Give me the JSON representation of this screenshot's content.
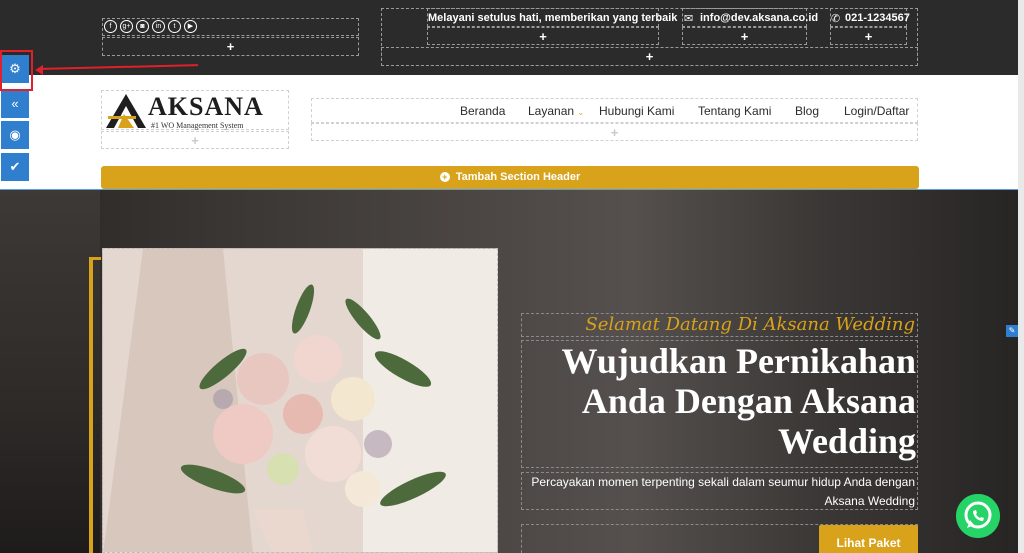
{
  "topbar": {
    "social_icons": [
      "facebook-icon",
      "google-plus-icon",
      "instagram-icon",
      "linkedin-icon",
      "twitter-icon",
      "youtube-icon"
    ],
    "tagline": "Melayani setulus hati, memberikan yang terbaik",
    "email": "info@dev.aksana.co.id",
    "phone": "021-1234567",
    "plus": "+"
  },
  "editor": {
    "tools": [
      "settings-icon",
      "collapse-icon",
      "preview-icon",
      "check-icon"
    ]
  },
  "brand": {
    "name": "AKSANA",
    "tagline": "#1 WO Management System"
  },
  "nav": {
    "items": [
      {
        "label": "Beranda"
      },
      {
        "label": "Layanan"
      },
      {
        "label": "Hubungi Kami"
      },
      {
        "label": "Tentang Kami"
      },
      {
        "label": "Blog"
      },
      {
        "label": "Login/Daftar"
      }
    ]
  },
  "header_section": {
    "add_label": "Tambah Section Header"
  },
  "hero": {
    "welcome": "Selamat Datang Di Aksana Wedding",
    "headline": "Wujudkan Pernikahan Anda Dengan Aksana Wedding",
    "subtitle": "Percayakan momen terpenting sekali dalam seumur hidup Anda dengan Aksana Wedding",
    "cta": "Lihat Paket"
  },
  "colors": {
    "gold": "#d9a21b",
    "editor_blue": "#2f7fce",
    "topbar": "#2b2b2b",
    "whatsapp": "#25d366"
  }
}
